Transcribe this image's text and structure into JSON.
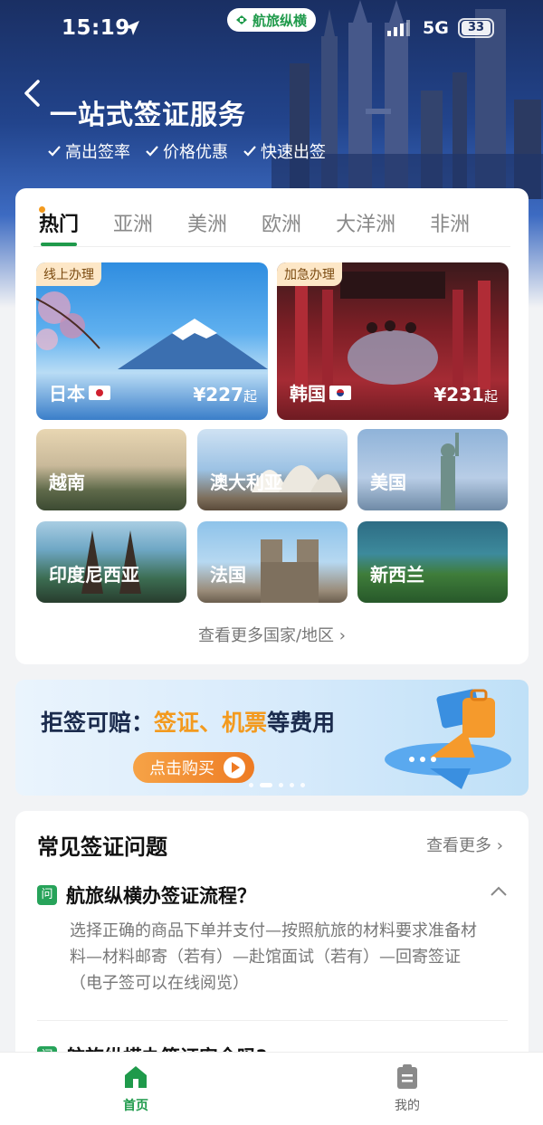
{
  "status_bar": {
    "time": "15:19",
    "brand": "航旅纵横",
    "network": "5G",
    "battery": "33"
  },
  "header": {
    "title": "一站式签证服务",
    "features": [
      "高出签率",
      "价格优惠",
      "快速出签"
    ]
  },
  "tabs": [
    "热门",
    "亚洲",
    "美洲",
    "欧洲",
    "大洋洲",
    "非洲"
  ],
  "active_tab": "热门",
  "featured": [
    {
      "badge": "线上办理",
      "name": "日本",
      "price": "¥227",
      "suffix": "起"
    },
    {
      "badge": "加急办理",
      "name": "韩国",
      "price": "¥231",
      "suffix": "起"
    }
  ],
  "countries": [
    "越南",
    "澳大利亚",
    "美国",
    "印度尼西亚",
    "法国",
    "新西兰"
  ],
  "more_countries": "查看更多国家/地区",
  "banner": {
    "prefix": "拒签可赔：",
    "hl1": "签证",
    "sep": "、",
    "hl2": "机票",
    "suffix": "等费用",
    "button": "点击购买",
    "slide_count": 5,
    "active_slide": 2
  },
  "faq": {
    "title": "常见签证问题",
    "more": "查看更多",
    "badge": "问",
    "question": "航旅纵横办签证流程？",
    "answer": "选择正确的商品下单并支付—按照航旅的材料要求准备材料—材料邮寄（若有）—赴馆面试（若有）—回寄签证（电子签可以在线阅览）",
    "next_question": "航旅纵横办签证安全吗?"
  },
  "bottom_nav": {
    "home": "首页",
    "mine": "我的"
  },
  "colors": {
    "accent_green": "#1f9a4b",
    "accent_orange": "#f39a1e",
    "hero_blue": "#22448c"
  }
}
